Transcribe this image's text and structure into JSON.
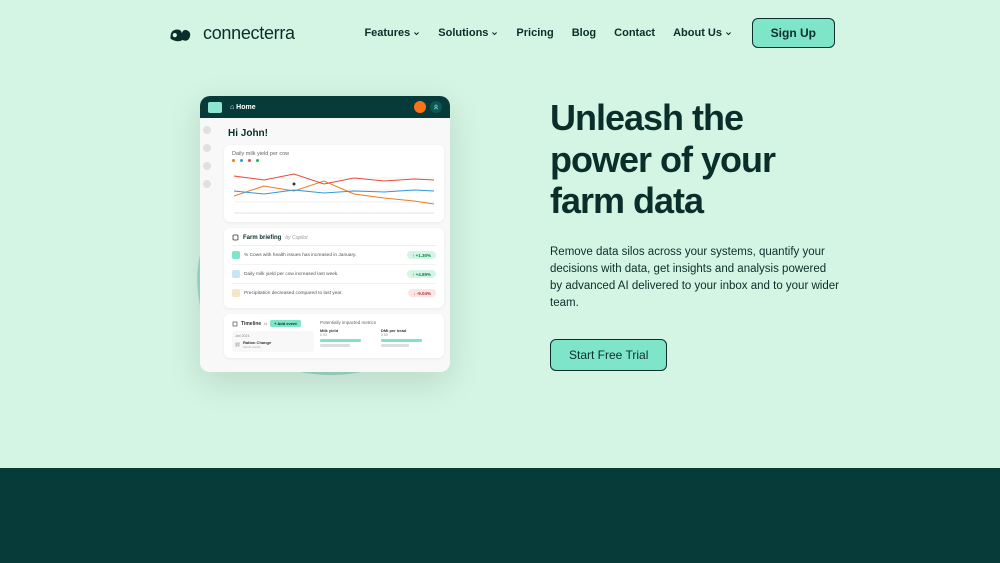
{
  "brand": {
    "name": "connecterra"
  },
  "nav": {
    "items": [
      {
        "label": "Features",
        "dropdown": true
      },
      {
        "label": "Solutions",
        "dropdown": true
      },
      {
        "label": "Pricing",
        "dropdown": false
      },
      {
        "label": "Blog",
        "dropdown": false
      },
      {
        "label": "Contact",
        "dropdown": false
      },
      {
        "label": "About Us",
        "dropdown": true
      }
    ],
    "signup": "Sign Up"
  },
  "hero": {
    "title": "Unleash the power of your farm data",
    "description": "Remove data silos across your systems, quantify your decisions with data, get insights and analysis powered by advanced AI delivered to your inbox and to your wider team.",
    "cta": "Start Free Trial"
  },
  "dashboard": {
    "home": "⌂ Home",
    "greeting": "Hi John!",
    "chart_title": "Daily milk yield per cow",
    "briefing": {
      "title": "Farm briefing",
      "by": "by Copilot",
      "items": [
        {
          "text": "% Cows with health issues has increased in January.",
          "pill": "↑ +1.30%",
          "type": "green"
        },
        {
          "text": "Daily milk yield per cow increased last week.",
          "pill": "↑ +4.89%",
          "type": "green"
        },
        {
          "text": "Precipitation decreased compared to last year.",
          "pill": "↓ -9.04%",
          "type": "red"
        }
      ]
    },
    "timeline": {
      "label": "Timeline",
      "tag": "+ Add event",
      "date": "Jan 2024",
      "item_title": "Ration Change",
      "item_sub": "Month trends"
    },
    "metrics": {
      "title": "Potentially impacted metrics",
      "items": [
        {
          "label": "Milk yield",
          "val": "0.93"
        },
        {
          "label": "DMI per head",
          "val": "0.85"
        }
      ]
    }
  },
  "colors": {
    "bg": "#d4f5e3",
    "accent": "#7ee5c9",
    "dark": "#0a2e2a",
    "footer": "#073b3a"
  }
}
